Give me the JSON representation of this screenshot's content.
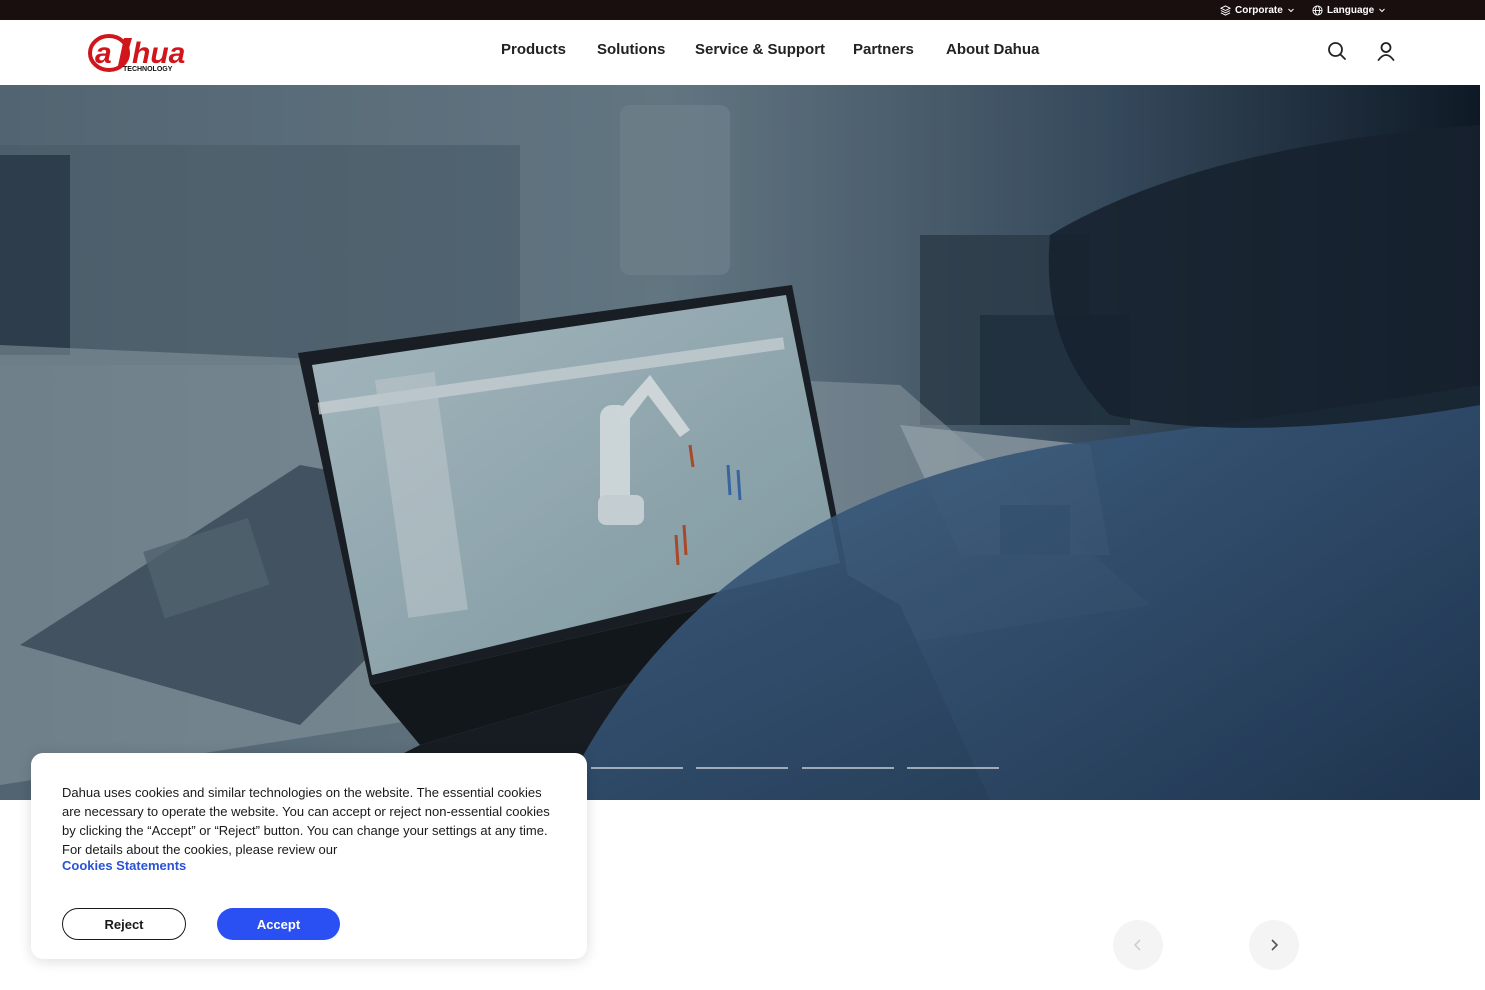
{
  "topbar": {
    "corporate_label": "Corporate",
    "language_label": "Language"
  },
  "brand": {
    "logo_text": "alhua",
    "logo_sub": "TECHNOLOGY",
    "brand_red": "#d0151b"
  },
  "nav": {
    "items": [
      {
        "label": "Products"
      },
      {
        "label": "Solutions"
      },
      {
        "label": "Service & Support"
      },
      {
        "label": "Partners"
      },
      {
        "label": "About Dahua"
      }
    ]
  },
  "header_icons": [
    "search-icon",
    "user-icon"
  ],
  "hero": {
    "slide_count": 4,
    "active_slide": 1
  },
  "cookie_banner": {
    "text": "Dahua uses cookies and similar technologies on the website. The essential cookies are necessary to operate the website. You can accept or reject non-essential cookies by clicking the “Accept” or “Reject” button. You can change your settings at any time. For details about the cookies, please review our",
    "link_label": "Cookies Statements",
    "reject_label": "Reject",
    "accept_label": "Accept",
    "accent_color": "#2a4ff2"
  },
  "carousel": {
    "prev_icon": "chevron-left-icon",
    "next_icon": "chevron-right-icon"
  }
}
